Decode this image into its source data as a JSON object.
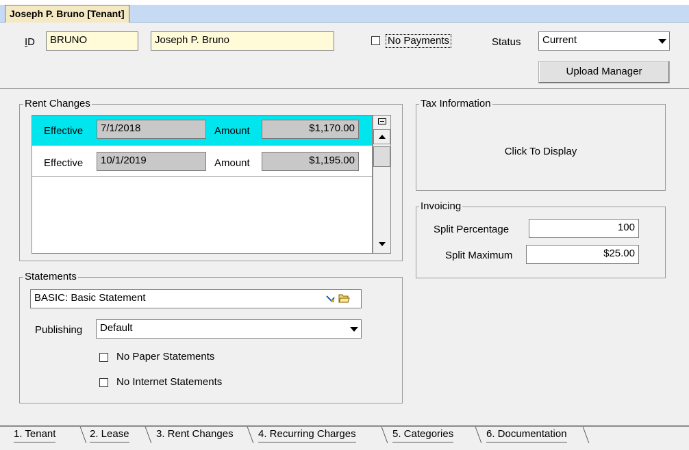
{
  "window": {
    "title_tab": "Joseph P. Bruno  [Tenant]"
  },
  "header": {
    "id_label": "ID",
    "id_value": "BRUNO",
    "name_value": "Joseph P. Bruno",
    "no_payments_label": "No Payments",
    "status_label": "Status",
    "status_value": "Current",
    "upload_manager": "Upload Manager"
  },
  "rent_changes": {
    "title": "Rent Changes",
    "effective_label": "Effective",
    "amount_label": "Amount",
    "rows": [
      {
        "effective": "7/1/2018",
        "amount": "$1,170.00",
        "selected": true
      },
      {
        "effective": "10/1/2019",
        "amount": "$1,195.00",
        "selected": false
      }
    ]
  },
  "tax_information": {
    "title": "Tax Information",
    "text": "Click To Display"
  },
  "invoicing": {
    "title": "Invoicing",
    "split_percentage_label": "Split Percentage",
    "split_percentage_value": "100",
    "split_maximum_label": "Split Maximum",
    "split_maximum_value": "$25.00"
  },
  "statements": {
    "title": "Statements",
    "statement_value": "BASIC: Basic Statement",
    "publishing_label": "Publishing",
    "publishing_value": "Default",
    "no_paper_label": "No Paper Statements",
    "no_internet_label": "No Internet Statements"
  },
  "tabs": [
    {
      "label": "1. Tenant"
    },
    {
      "label": "2. Lease"
    },
    {
      "label": "3. Rent Changes",
      "active": true
    },
    {
      "label": "4. Recurring Charges"
    },
    {
      "label": "5. Categories"
    },
    {
      "label": "6. Documentation"
    }
  ],
  "colors": {
    "selected_row": "#00e5ee",
    "title_tab": "#f5e9c4",
    "title_bar": "#c7daf3",
    "yellow_field": "#fffbd9"
  }
}
